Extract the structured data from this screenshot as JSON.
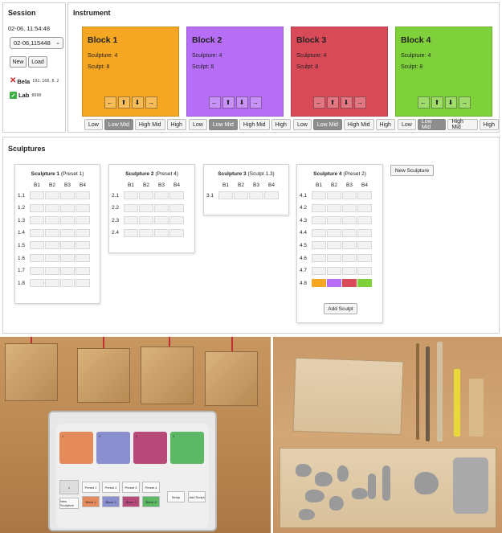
{
  "session": {
    "title": "Session",
    "time": "02-06, 11:54:48",
    "selected": "02-06,115448",
    "new_label": "New",
    "load_label": "Load",
    "bela_label": "Bela",
    "bela_ip": "192.168.8.2",
    "lab_label": "Lab",
    "lab_port": "8690"
  },
  "instrument": {
    "title": "Instrument",
    "blocks": [
      {
        "name": "Block 1",
        "sculpture": "Sculpture: 4",
        "sculpt": "Sculpt: 8",
        "color": "#f5a623"
      },
      {
        "name": "Block 2",
        "sculpture": "Sculpture: 4",
        "sculpt": "Sculpt: 8",
        "color": "#b76ef6"
      },
      {
        "name": "Block 3",
        "sculpture": "Sculpture: 4",
        "sculpt": "Sculpt: 8",
        "color": "#d84a58"
      },
      {
        "name": "Block 4",
        "sculpture": "Sculpture: 4",
        "sculpt": "Sculpt: 8",
        "color": "#7fd13b"
      }
    ],
    "arrows": [
      "←",
      "⬆",
      "⬇",
      "→"
    ],
    "levels": [
      "Low",
      "Low Mid",
      "High Mid",
      "High"
    ],
    "active_level": "Low Mid"
  },
  "sculptures": {
    "title": "Sculptures",
    "new_sculpture_label": "New Sculpture",
    "add_sculpt_label": "Add Sculpt",
    "columns": [
      "B1",
      "B2",
      "B3",
      "B4"
    ],
    "cards": [
      {
        "name": "Sculpture 1",
        "note": "(Preset 1)",
        "rows": [
          "1.1",
          "1.2",
          "1.3",
          "1.4",
          "1.5",
          "1.6",
          "1.7",
          "1.8"
        ]
      },
      {
        "name": "Sculpture 2",
        "note": "(Preset 4)",
        "rows": [
          "2.1",
          "2.2",
          "2.3",
          "2.4"
        ]
      },
      {
        "name": "Sculpture 3",
        "note": "(Sculpt 1.3)",
        "rows": [
          "3.1"
        ]
      },
      {
        "name": "Sculpture 4",
        "note": "(Preset 2)",
        "rows": [
          "4.1",
          "4.2",
          "4.3",
          "4.4",
          "4.5",
          "4.6",
          "4.7",
          "4.8"
        ]
      }
    ],
    "filled_row_colors": [
      "#f5a623",
      "#b76ef6",
      "#d84a58",
      "#7fd13b"
    ]
  },
  "photo_pad": {
    "block_numbers": [
      "1",
      "2",
      "3",
      "4"
    ],
    "presets": [
      "Preset 1",
      "Preset 2",
      "Preset 3",
      "Preset 4"
    ],
    "block_keys": [
      "Block 1",
      "Block 2",
      "Block 3",
      "Block 4"
    ],
    "new_sculpture": "New Sculpture",
    "setup": "Setup",
    "add_sculpt": "Add Sculpt"
  }
}
